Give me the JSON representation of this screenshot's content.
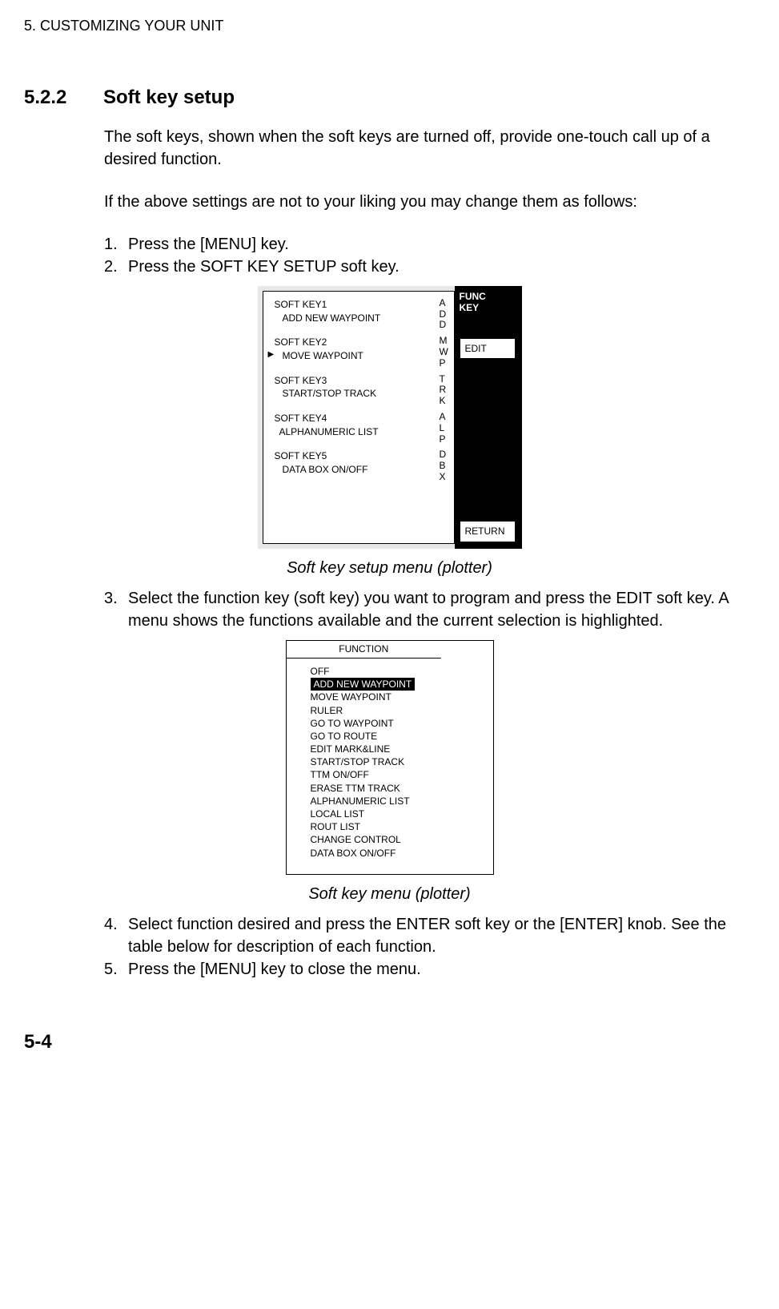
{
  "header": "5. CUSTOMIZING YOUR UNIT",
  "section": {
    "number": "5.2.2",
    "title": "Soft key setup"
  },
  "para1": "The soft keys, shown when the soft keys are turned off, provide one-touch call up of a desired function.",
  "para2": "If the above settings are not to your liking you may change them as follows:",
  "steps": {
    "s1num": "1.",
    "s1": "Press the [MENU] key.",
    "s2num": "2.",
    "s2": "Press the SOFT KEY SETUP soft key.",
    "s3num": "3.",
    "s3": "Select the function key (soft key) you want to program and press the EDIT soft key. A menu shows the functions available and the current selection is highlighted.",
    "s4num": "4.",
    "s4": "Select function desired and press the ENTER soft key or the [ENTER] knob. See the table below for description of each function.",
    "s5num": "5.",
    "s5": "Press the [MENU] key to close the menu."
  },
  "fig1": {
    "sk1": "SOFT KEY1",
    "sk1v": "ADD NEW WAYPOINT",
    "sk1c1": "A",
    "sk1c2": "D",
    "sk1c3": "D",
    "sk2": "SOFT KEY2",
    "sk2v": "MOVE WAYPOINT",
    "sk2c1": "M",
    "sk2c2": "W",
    "sk2c3": "P",
    "sk3": "SOFT KEY3",
    "sk3v": "START/STOP TRACK",
    "sk3c1": "T",
    "sk3c2": "R",
    "sk3c3": "K",
    "sk4": "SOFT KEY4",
    "sk4v": "ALPHANUMERIC LIST",
    "sk4c1": "A",
    "sk4c2": "L",
    "sk4c3": "P",
    "sk5": "SOFT KEY5",
    "sk5v": "DATA BOX ON/OFF",
    "sk5c1": "D",
    "sk5c2": "B",
    "sk5c3": "X",
    "funcKey1": "FUNC",
    "funcKey2": "KEY",
    "editBtn": "EDIT",
    "returnBtn": "RETURN",
    "caption": "Soft key setup menu (plotter)",
    "cursor": "▶"
  },
  "fig2": {
    "title": "FUNCTION",
    "items": {
      "i0": "OFF",
      "i1": "ADD NEW WAYPOINT",
      "i2": "MOVE WAYPOINT",
      "i3": "RULER",
      "i4": "GO TO WAYPOINT",
      "i5": "GO TO ROUTE",
      "i6": "EDIT MARK&LINE",
      "i7": "START/STOP TRACK",
      "i8": "TTM ON/OFF",
      "i9": "ERASE TTM TRACK",
      "i10": "ALPHANUMERIC LIST",
      "i11": "LOCAL LIST",
      "i12": "ROUT LIST",
      "i13": "CHANGE CONTROL",
      "i14": "DATA BOX ON/OFF"
    },
    "caption": "Soft key menu (plotter)"
  },
  "pageNumber": "5-4"
}
